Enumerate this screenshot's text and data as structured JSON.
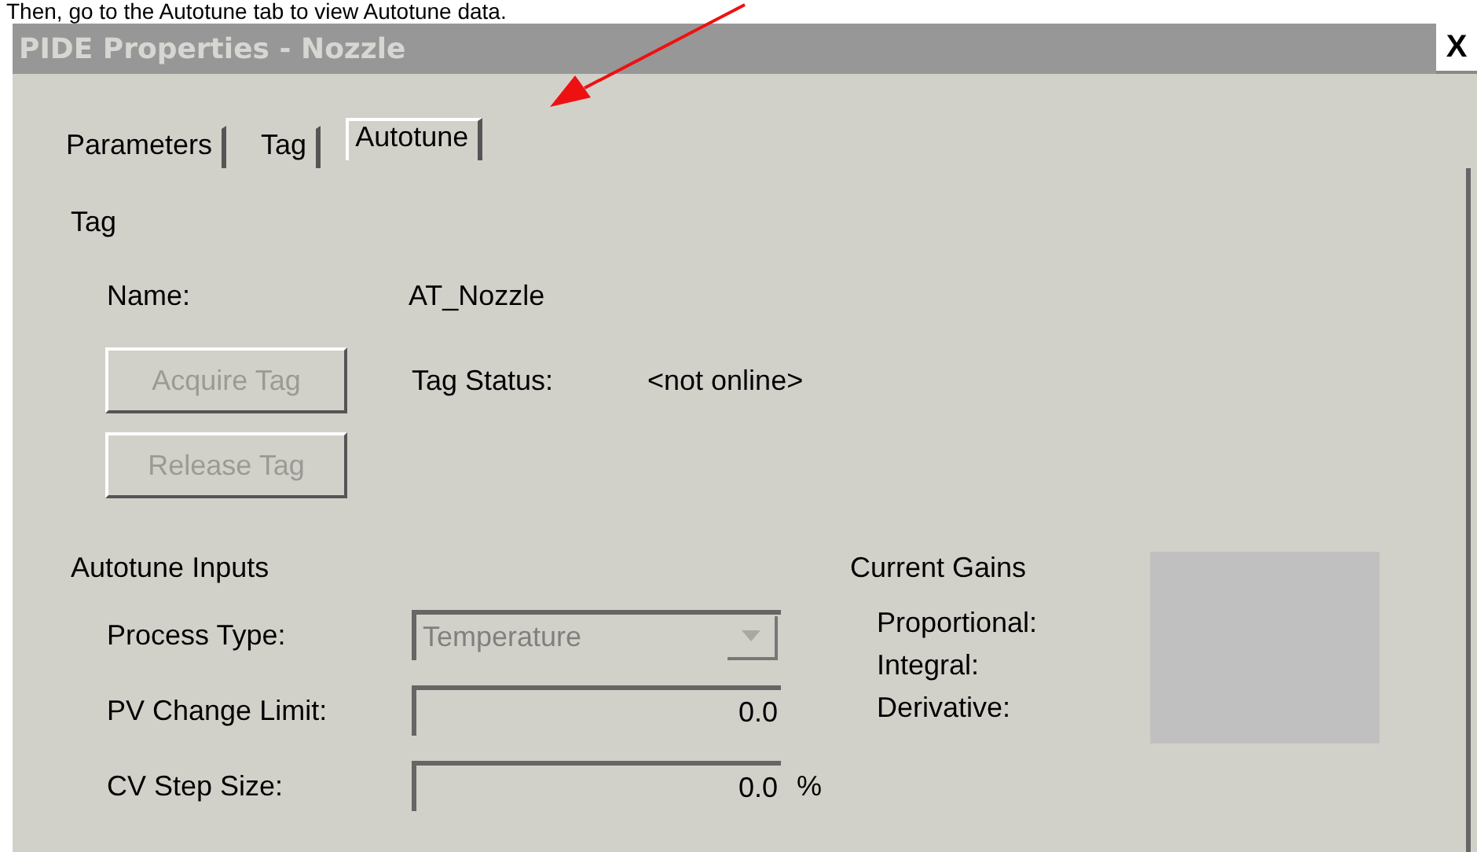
{
  "caption": "Then, go to the Autotune tab to view Autotune data.",
  "window": {
    "title": "PIDE Properties - Nozzle",
    "close": "X"
  },
  "tabs": [
    {
      "label": "Parameters",
      "selected": false
    },
    {
      "label": "Tag",
      "selected": false
    },
    {
      "label": "Autotune",
      "selected": true
    }
  ],
  "tag_section": {
    "heading": "Tag",
    "name_label": "Name:",
    "name_value": "AT_Nozzle",
    "status_label": "Tag Status:",
    "status_value": "<not online>",
    "buttons": [
      {
        "label": "Acquire Tag",
        "disabled": true
      },
      {
        "label": "Release Tag",
        "disabled": true
      }
    ]
  },
  "autotune_inputs": {
    "heading": "Autotune Inputs",
    "fields": [
      {
        "kind": "dropdown",
        "label": "Process Type:",
        "value": "Temperature",
        "disabled": true
      },
      {
        "kind": "number",
        "label": "PV Change Limit:",
        "value": "0.0",
        "disabled": false
      },
      {
        "kind": "number",
        "label": "CV Step Size:",
        "value": "0.0",
        "unit": "%",
        "disabled": false
      }
    ]
  },
  "current_gains": {
    "heading": "Current Gains",
    "labels": [
      "Proportional:",
      "Integral:",
      "Derivative:"
    ]
  }
}
